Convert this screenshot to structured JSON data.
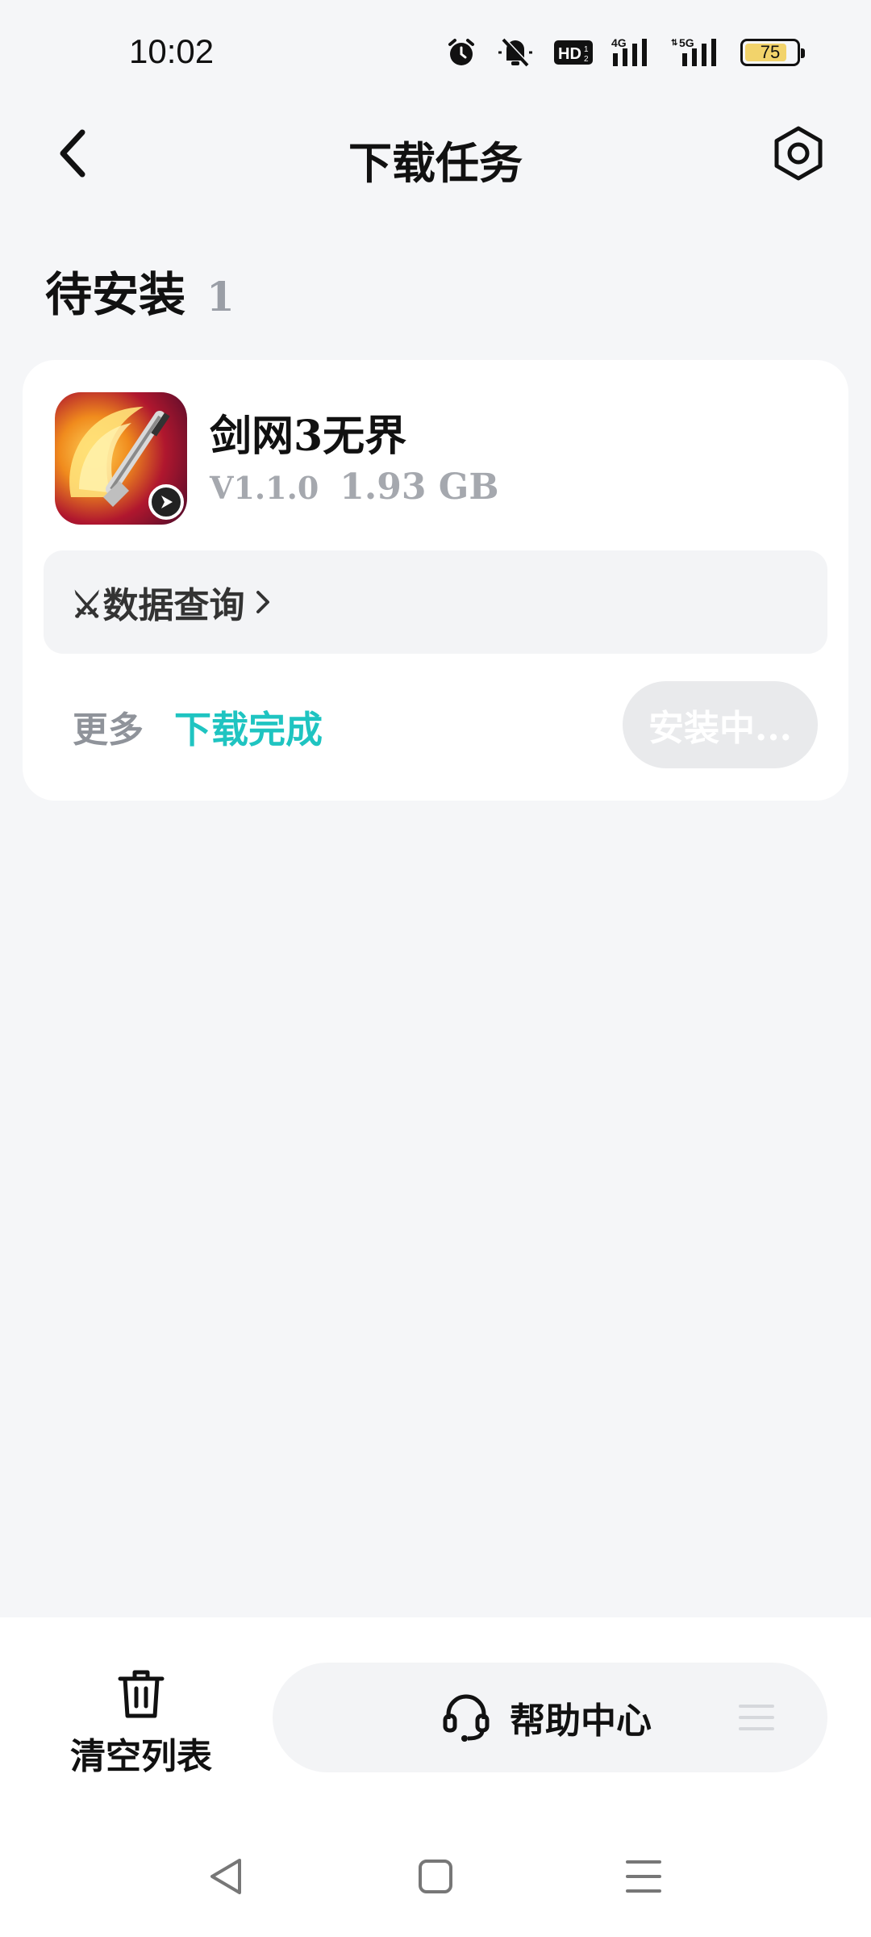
{
  "status_bar": {
    "time": "10:02",
    "battery_level": "75",
    "icons": [
      "alarm-icon",
      "mute-icon",
      "hd-icon",
      "signal-4g-icon",
      "signal-5g-icon",
      "battery-icon"
    ],
    "network_4g": "4G",
    "network_5g": "5G",
    "hd_label": "HD"
  },
  "header": {
    "title": "下载任务",
    "back_icon": "chevron-left-icon",
    "settings_icon": "settings-icon"
  },
  "section": {
    "title": "待安装",
    "count": "1"
  },
  "app": {
    "name": "剑网3无界",
    "version": "V1.1.0",
    "size": "1.93 GB",
    "data_query_label": "⚔数据查询",
    "more_label": "更多",
    "download_status": "下载完成",
    "install_button_label": "安装中...",
    "status_color": "#1fc4c1"
  },
  "bottom_bar": {
    "clear_list_label": "清空列表",
    "help_center_label": "帮助中心"
  },
  "colors": {
    "background": "#f5f6f8",
    "card": "#ffffff",
    "accent": "#1fc4c1",
    "muted": "#9a9ea6"
  }
}
